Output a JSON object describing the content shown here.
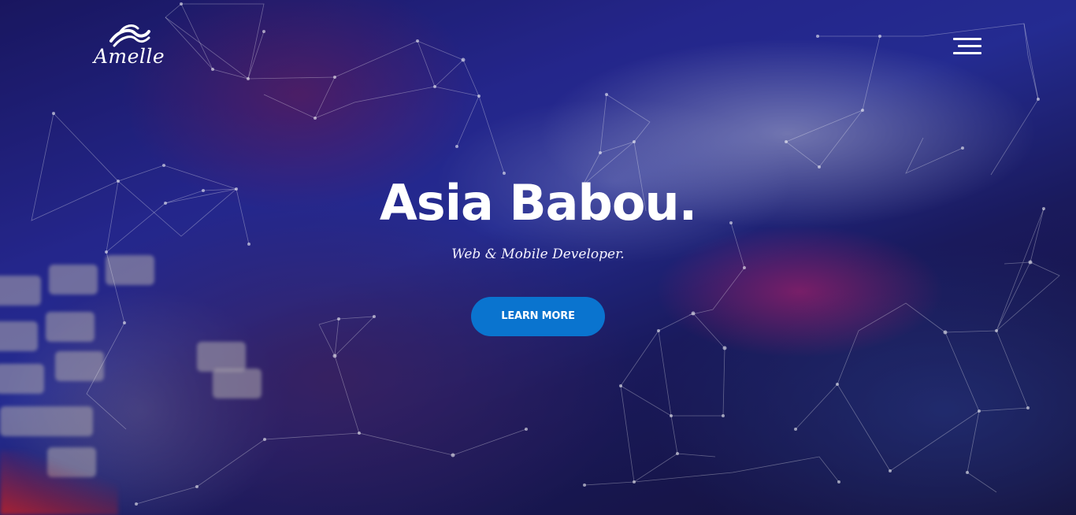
{
  "brand": {
    "logo_text": "Amelle",
    "logo_icon": "hair-wave-icon"
  },
  "header": {
    "menu_icon": "hamburger-menu-icon"
  },
  "hero": {
    "title": "Asia Babou.",
    "subtitle": "Web & Mobile Developer.",
    "cta_label": "LEARN MORE"
  },
  "colors": {
    "accent": "#0a74cf",
    "text": "#ffffff"
  }
}
